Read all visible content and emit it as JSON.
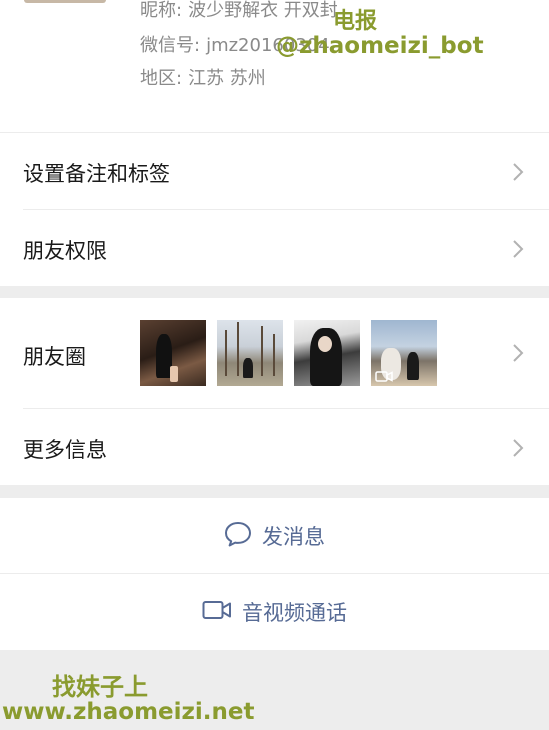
{
  "profile": {
    "nickname_label": "昵称:",
    "nickname_value": "波少野解衣 开双封",
    "wechat_label": "微信号:",
    "wechat_value": "jmz20160304",
    "region_label": "地区:",
    "region_value": "江苏  苏州"
  },
  "rows": {
    "remark": "设置备注和标签",
    "permissions": "朋友权限",
    "moments": "朋友圈",
    "more_info": "更多信息"
  },
  "moments_thumbnails": [
    {
      "name": "moments-photo-1",
      "kind": "photo"
    },
    {
      "name": "moments-photo-2",
      "kind": "photo"
    },
    {
      "name": "moments-photo-3",
      "kind": "photo"
    },
    {
      "name": "moments-photo-4",
      "kind": "video"
    }
  ],
  "actions": {
    "message": "发消息",
    "call": "音视频通话"
  },
  "icons": {
    "row_chevron": "chevron-right-icon",
    "message": "chat-bubble-icon",
    "call": "video-camera-icon"
  },
  "colors": {
    "link_blue": "#576b95",
    "separator_gray": "#ededed",
    "watermark": "#8a9b2f"
  },
  "watermarks": {
    "line1": "电报",
    "line2": "@zhaomeizi_bot",
    "line3": "找妹子上",
    "line4": "www.zhaomeizi.net"
  }
}
